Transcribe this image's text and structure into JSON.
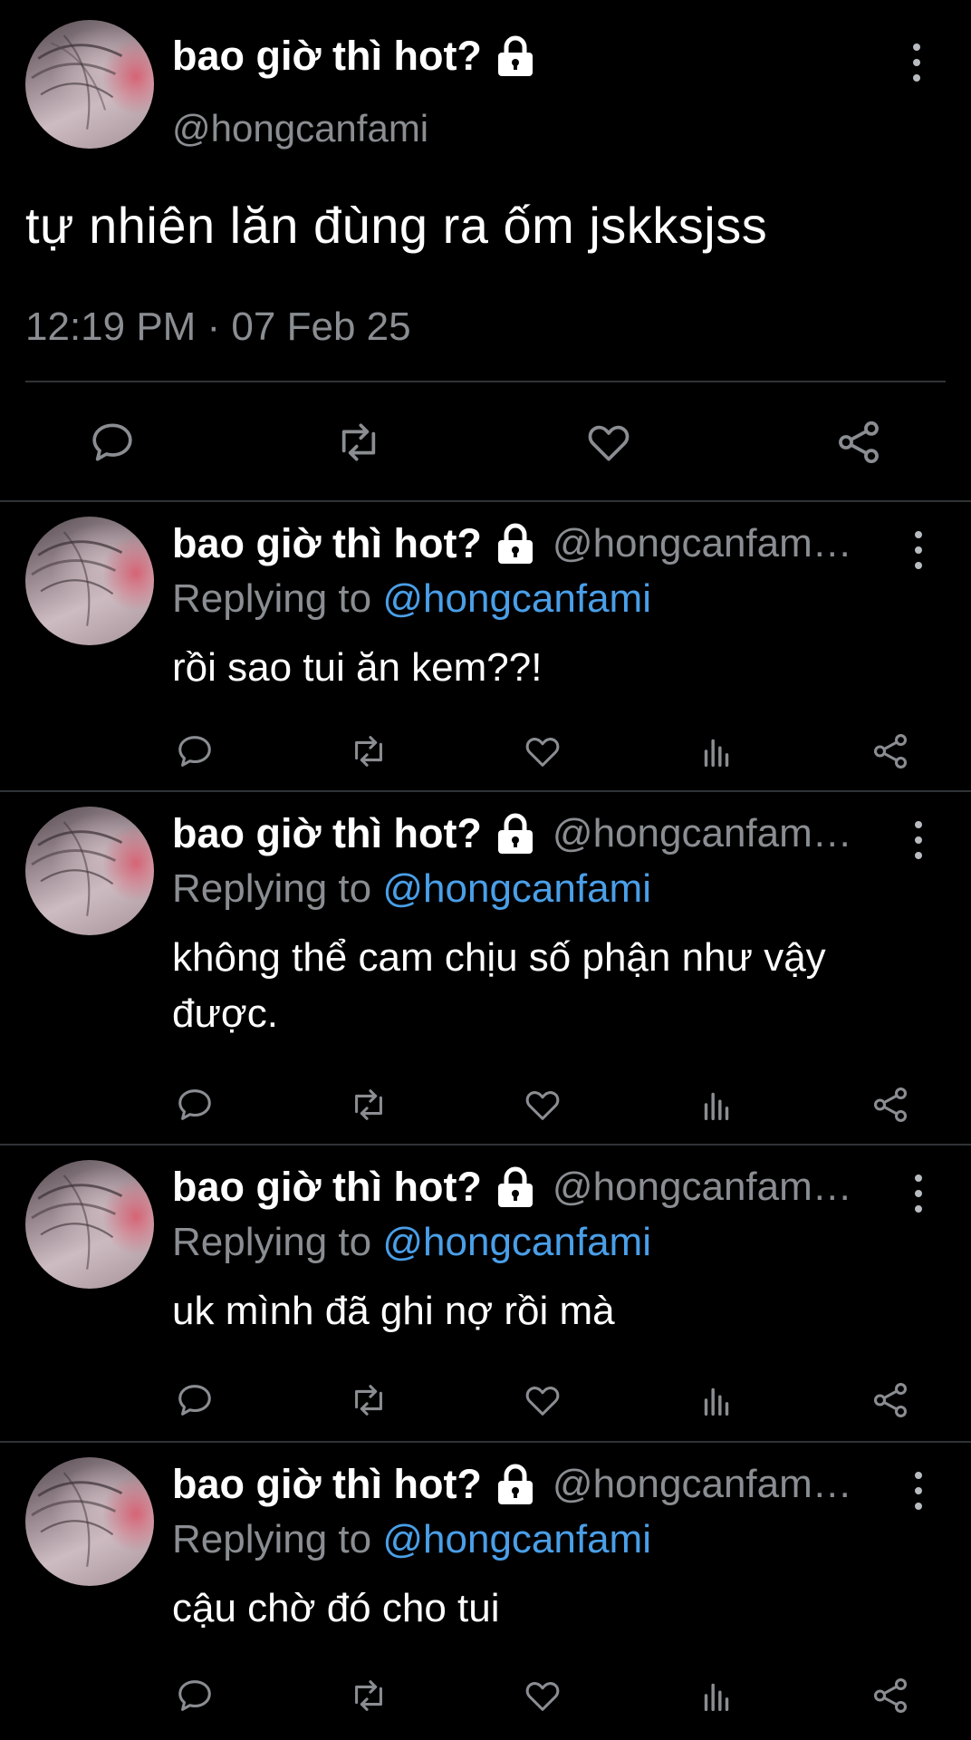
{
  "main_tweet": {
    "display_name": "bao giờ thì hot?",
    "handle": "@hongcanfami",
    "text": "tự nhiên lăn đùng ra ốm jskksjss",
    "timestamp": "12:19 PM · 07 Feb 25",
    "icons": [
      "lock-icon",
      "more-icon",
      "reply-icon",
      "retweet-icon",
      "like-icon",
      "share-icon"
    ]
  },
  "replies": [
    {
      "display_name": "bao giờ thì hot?",
      "handle": "@hongcanfam…",
      "replying_prefix": "Replying to",
      "replying_to": "@hongcanfami",
      "text": "rồi sao tui ăn kem??!"
    },
    {
      "display_name": "bao giờ thì hot?",
      "handle": "@hongcanfam…",
      "replying_prefix": "Replying to",
      "replying_to": "@hongcanfami",
      "text": "không thể cam chịu số phận như vậy được."
    },
    {
      "display_name": "bao giờ thì hot?",
      "handle": "@hongcanfam…",
      "replying_prefix": "Replying to",
      "replying_to": "@hongcanfami",
      "text": "uk mình đã ghi nợ rồi mà"
    },
    {
      "display_name": "bao giờ thì hot?",
      "handle": "@hongcanfam…",
      "replying_prefix": "Replying to",
      "replying_to": "@hongcanfami",
      "text": "cậu chờ đó cho tui"
    }
  ],
  "reply_icons": [
    "reply-icon",
    "retweet-icon",
    "like-icon",
    "views-icon",
    "share-icon"
  ],
  "colors": {
    "background": "#000000",
    "text": "#ffffff",
    "secondary": "#8a8d91",
    "mention": "#4a9fe8",
    "divider": "#2f3336"
  }
}
